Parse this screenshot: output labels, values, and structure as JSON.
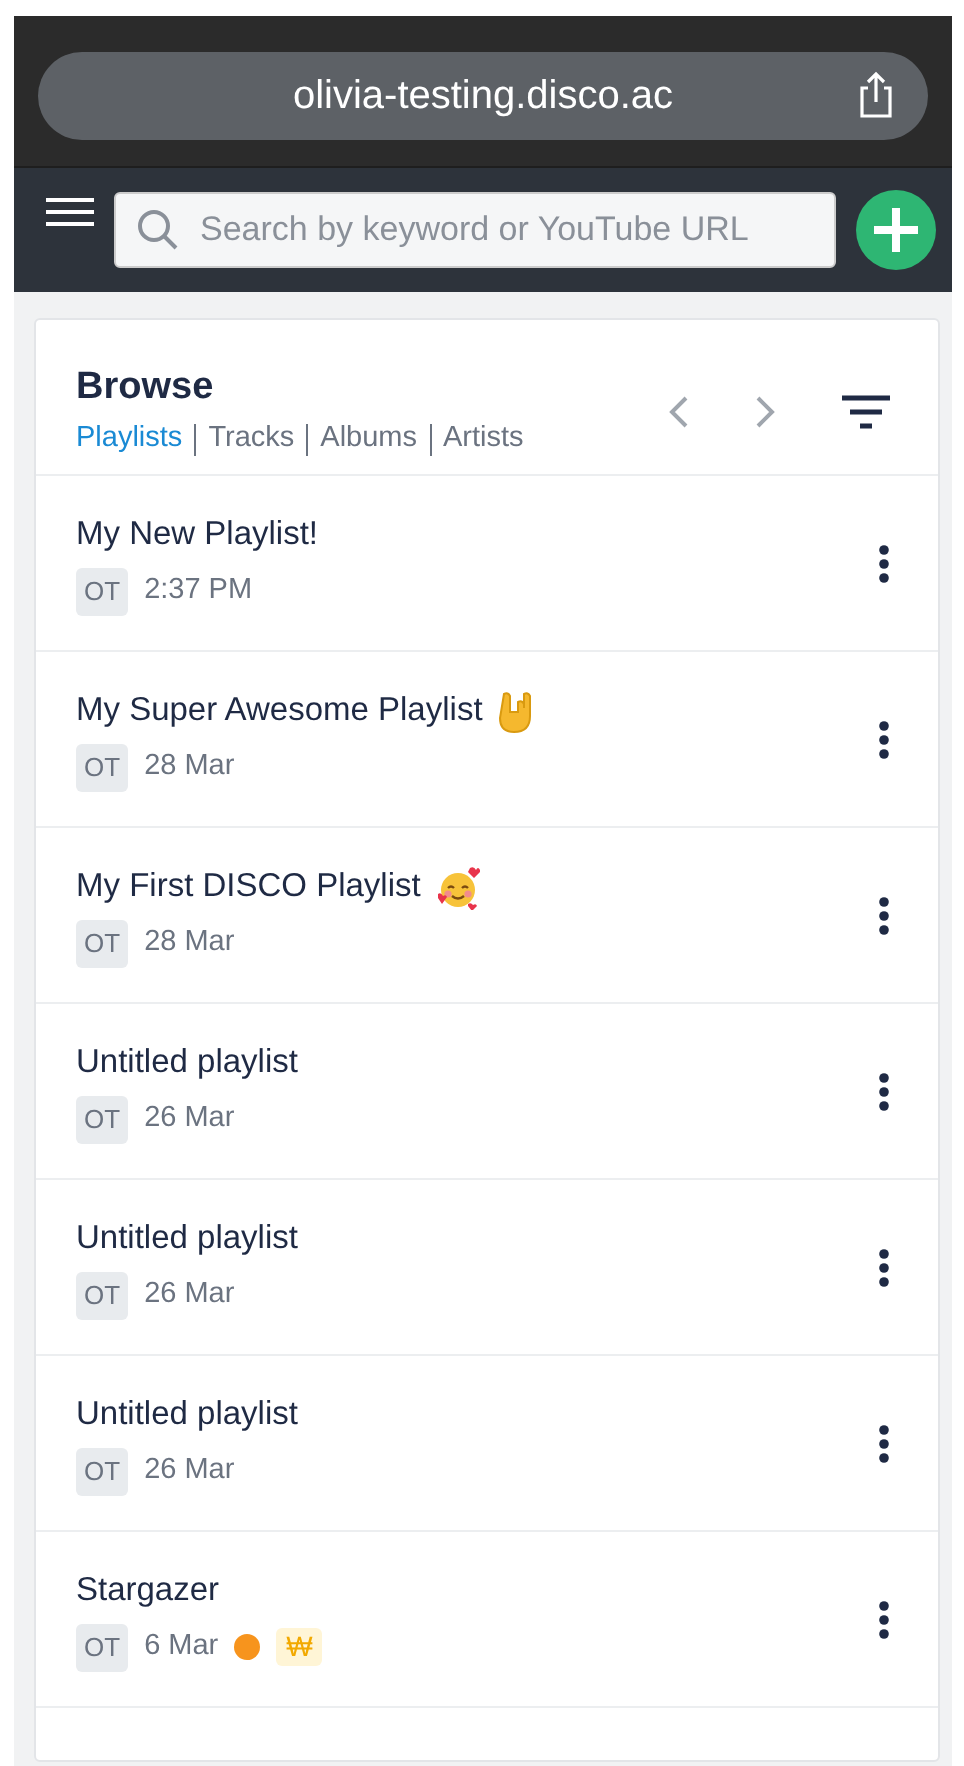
{
  "browser": {
    "url": "olivia-testing.disco.ac"
  },
  "search": {
    "placeholder": "Search by keyword or YouTube URL"
  },
  "browse": {
    "title": "Browse",
    "tabs": [
      {
        "label": "Playlists",
        "selected": true
      },
      {
        "label": "Tracks",
        "selected": false
      },
      {
        "label": "Albums",
        "selected": false
      },
      {
        "label": "Artists",
        "selected": false
      }
    ]
  },
  "playlists": [
    {
      "name": "My New Playlist!",
      "owner": "OT",
      "date": "2:37 PM"
    },
    {
      "name": "My Super Awesome Playlist",
      "kind": "rock-hand",
      "owner": "OT",
      "date": "28 Mar"
    },
    {
      "name": "My First DISCO Playlist",
      "kind": "smiling-hearts",
      "owner": "OT",
      "date": "28 Mar"
    },
    {
      "name": "Untitled playlist",
      "owner": "OT",
      "date": "26 Mar"
    },
    {
      "name": "Untitled playlist",
      "owner": "OT",
      "date": "26 Mar"
    },
    {
      "name": "Untitled playlist",
      "owner": "OT",
      "date": "26 Mar"
    },
    {
      "name": "Stargazer",
      "owner": "OT",
      "date": "6 Mar",
      "color": "#f7941d",
      "tag": "₩"
    }
  ]
}
